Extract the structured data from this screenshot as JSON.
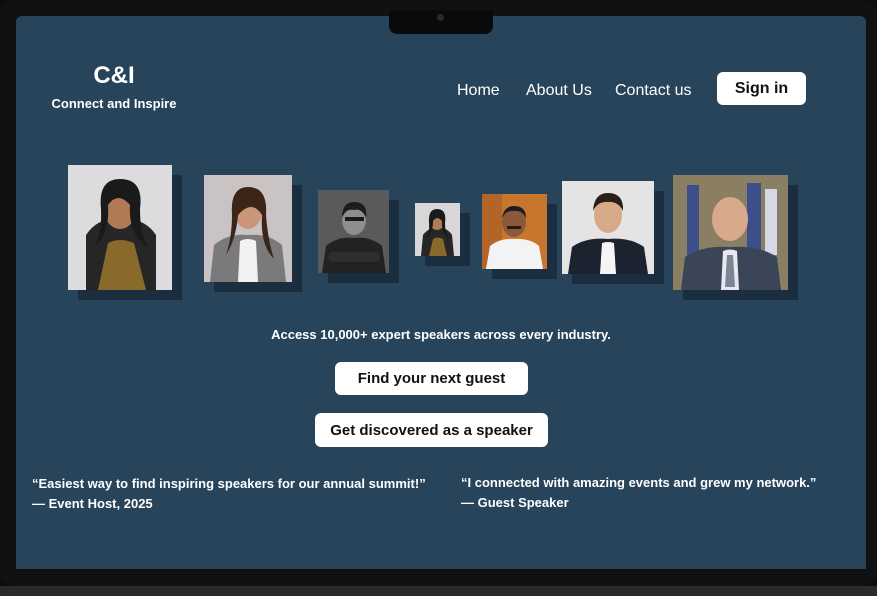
{
  "brand": {
    "title": "C&I",
    "tagline": "Connect and Inspire"
  },
  "nav": {
    "items": [
      {
        "label": "Home"
      },
      {
        "label": "About Us"
      },
      {
        "label": "Contact us"
      }
    ],
    "signin_label": "Sign in"
  },
  "hero": {
    "tagline": "Access 10,000+ expert speakers across every industry.",
    "find_guest_label": "Find your next guest",
    "become_speaker_label": "Get discovered as a speaker"
  },
  "testimonials": [
    {
      "quote": "“Easiest way to find inspiring speakers for our annual summit!”",
      "author": "— Event Host, 2025"
    },
    {
      "quote": "“I connected with amazing events and grew my network.”",
      "author": "— Guest Speaker"
    }
  ],
  "colors": {
    "screen_background": "#27445a",
    "button_background": "#ffffff",
    "text": "#ffffff"
  }
}
